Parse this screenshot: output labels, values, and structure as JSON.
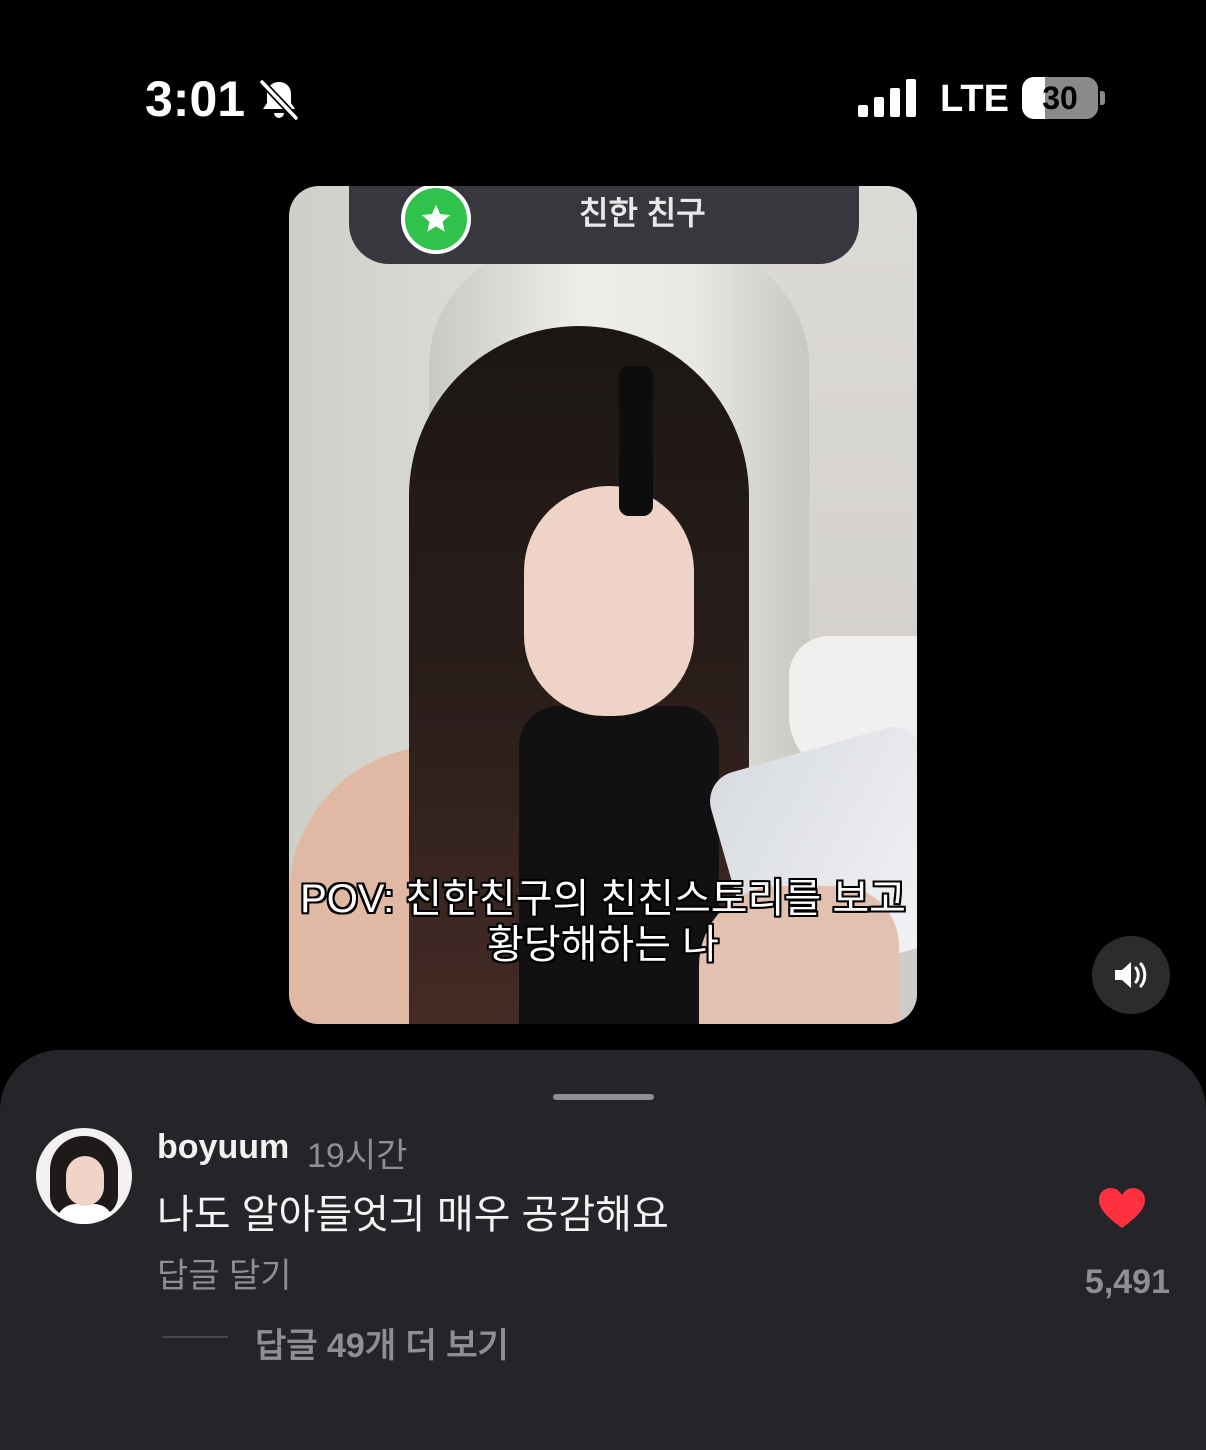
{
  "status_bar": {
    "time": "3:01",
    "network": "LTE",
    "battery": "30",
    "battery_level": 0.3,
    "icons": [
      "bell-slash-icon",
      "signal-icon"
    ]
  },
  "video": {
    "overlay_label": "친한 친구",
    "caption_line1": "POV: 친한친구의 친친스토리를 보고",
    "caption_line2": "황당해하는 나",
    "icons": [
      "star-icon",
      "speaker-icon"
    ]
  },
  "comment": {
    "username": "boyuum",
    "time_ago": "19시간",
    "text": "나도 알아들엇긔 매우 공감해요",
    "reply_label": "답글 달기",
    "like_count": "5,491",
    "view_replies": "답글 49개 더 보기",
    "icons": [
      "heart-icon"
    ],
    "colors": {
      "heart": "#ff3040",
      "sheet_bg": "#242528"
    }
  }
}
